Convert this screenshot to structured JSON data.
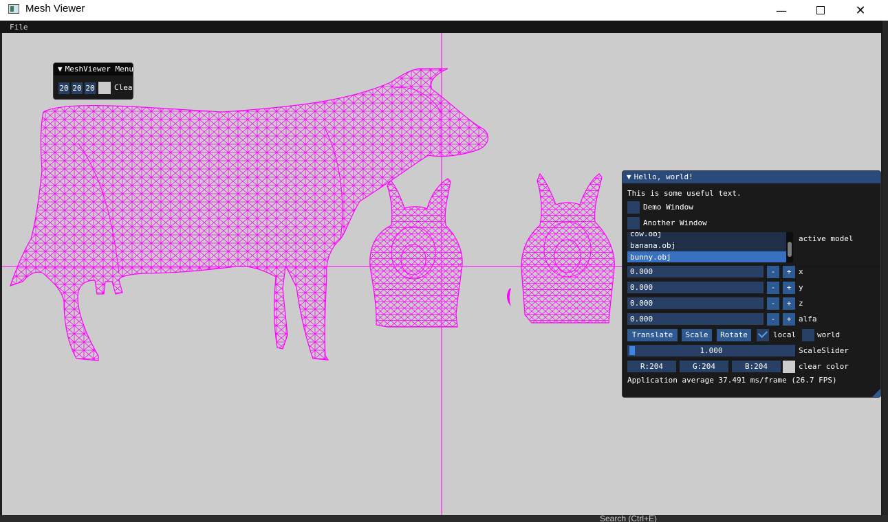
{
  "window": {
    "title": "Mesh Viewer",
    "minimize_icon": "minimize-icon",
    "maximize_icon": "maximize-icon",
    "close_icon": "close-icon"
  },
  "menubar": {
    "file": "File"
  },
  "colors": {
    "wire": "#ff00ff",
    "clear": "#cccccc",
    "accent": "#294a7a"
  },
  "mini_window": {
    "title": "MeshViewer Menu",
    "fields": [
      "20",
      "20",
      "20"
    ],
    "clear_label": "Clear"
  },
  "hello": {
    "title": "Hello, world!",
    "text": "This is some useful text.",
    "demo_window": "Demo Window",
    "another_window": "Another Window",
    "models": [
      "cow.obj",
      "banana.obj",
      "bunny.obj"
    ],
    "selected_model": "bunny.obj",
    "active_model_label": "active model",
    "inputs": [
      {
        "label": "x",
        "value": "0.000"
      },
      {
        "label": "y",
        "value": "0.000"
      },
      {
        "label": "z",
        "value": "0.000"
      },
      {
        "label": "alfa",
        "value": "0.000"
      }
    ],
    "minus": "-",
    "plus": "+",
    "translate": "Translate",
    "scale": "Scale",
    "rotate": "Rotate",
    "local": "local",
    "local_checked": true,
    "world": "world",
    "world_checked": false,
    "scale_value": "1.000",
    "scale_label": "ScaleSlider",
    "r": "R:204",
    "g": "G:204",
    "b": "B:204",
    "clear_color": "clear color",
    "fps": "Application average 37.491 ms/frame (26.7 FPS)"
  },
  "bottom": {
    "search": "Search (Ctrl+E)"
  }
}
